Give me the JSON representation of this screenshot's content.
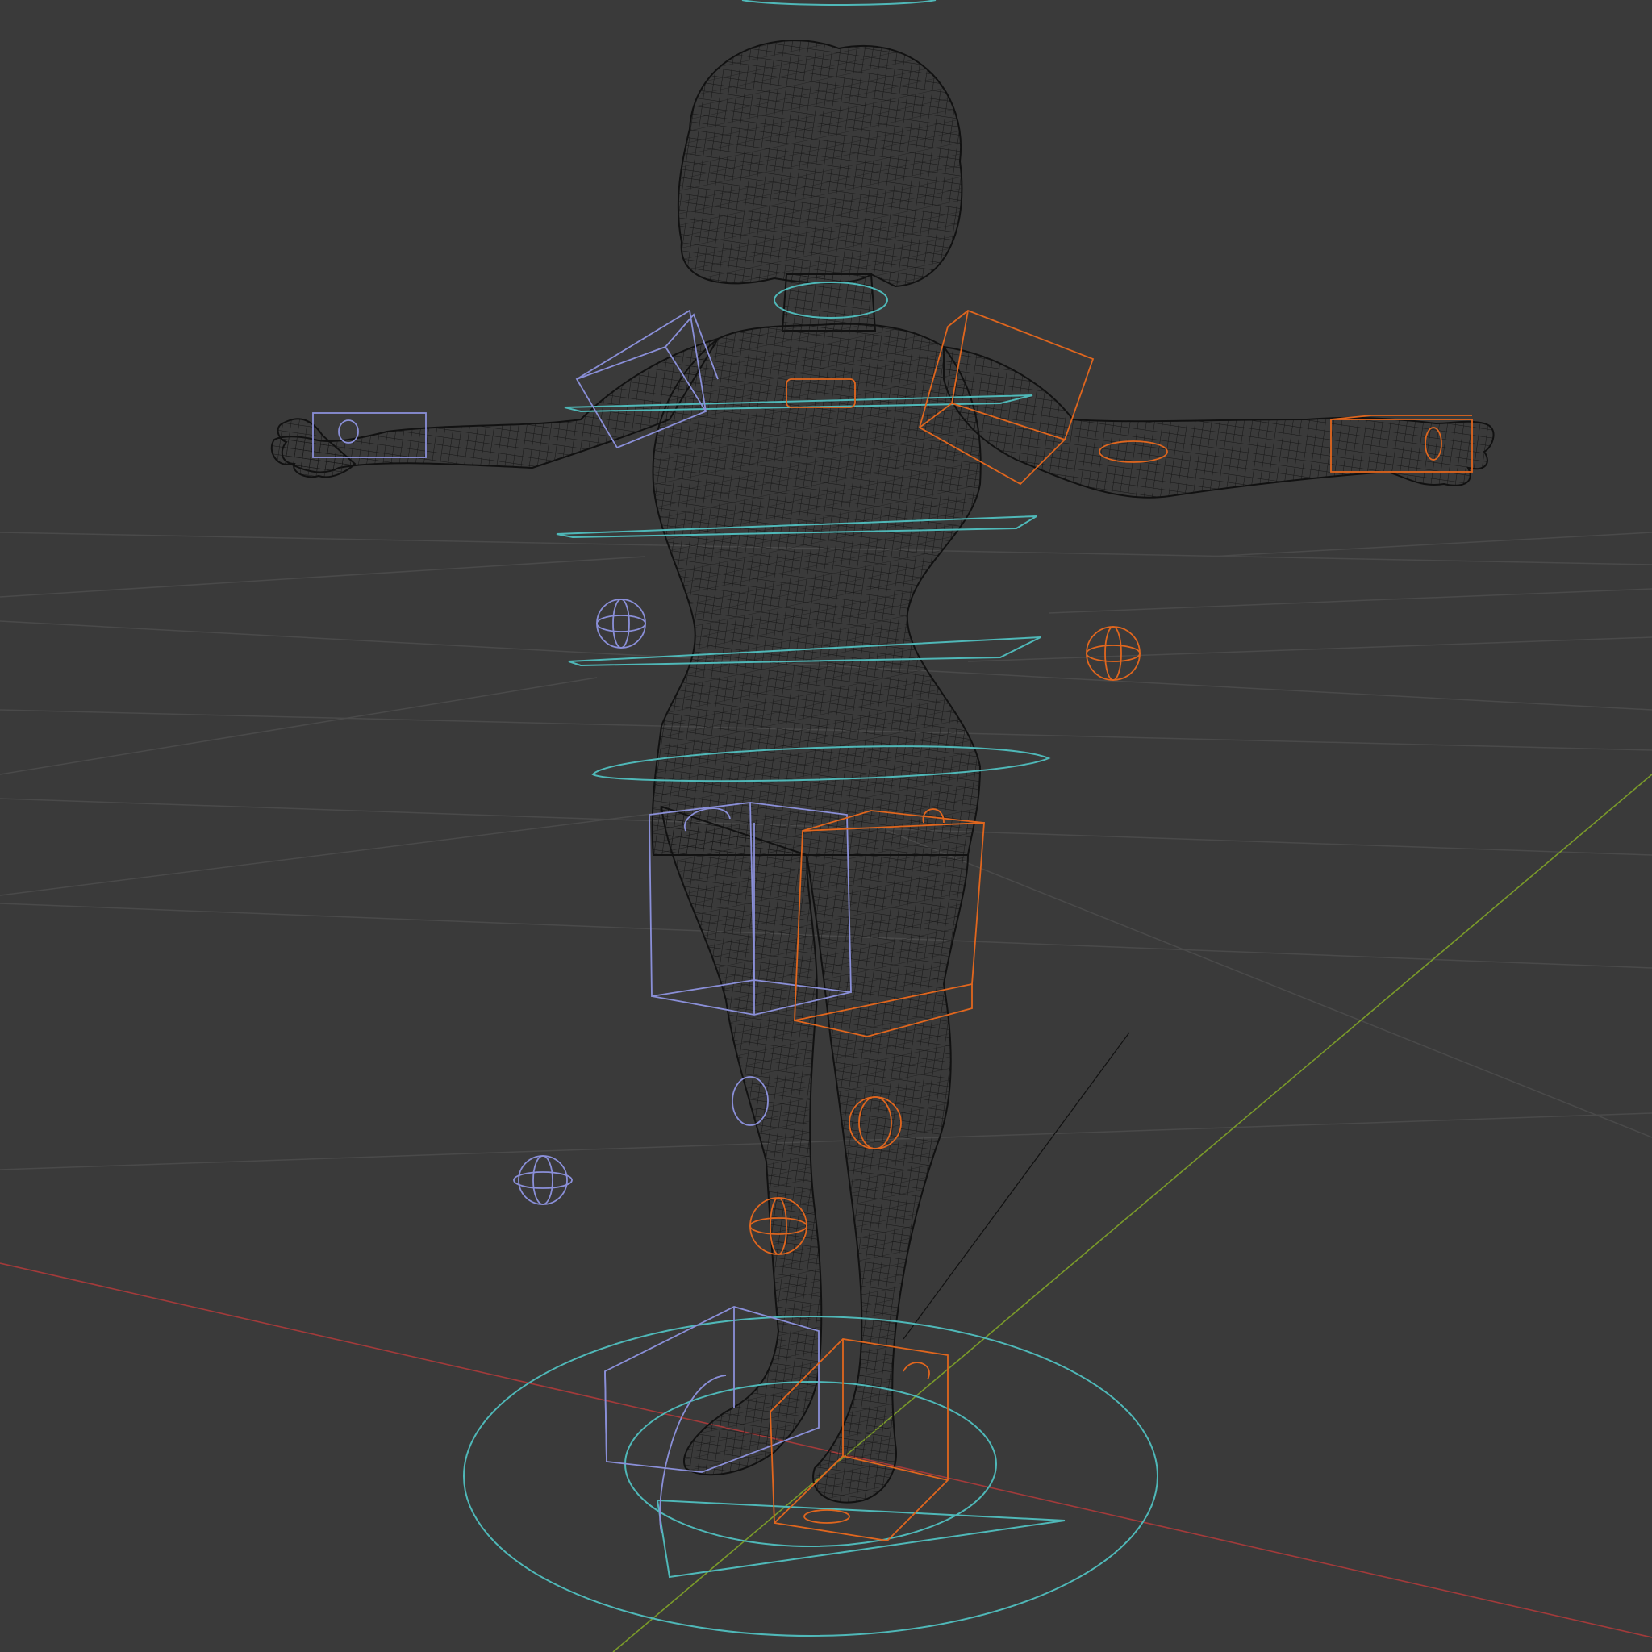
{
  "viewport": {
    "background": "#3a3a3a",
    "grid_color": "#4a4a4a",
    "axis_x_color": "#a33a3a",
    "axis_y_color": "#7a9a2a",
    "mesh_color": "#141414",
    "controls": {
      "center": "#4fb8b8",
      "left": "#8a8fd8",
      "right": "#e0661e"
    }
  },
  "icons": {
    "character_mesh": "wireframe-humanoid",
    "rig_root": "circle-control",
    "ik_target": "sphere-control",
    "fk_control": "box-control"
  }
}
